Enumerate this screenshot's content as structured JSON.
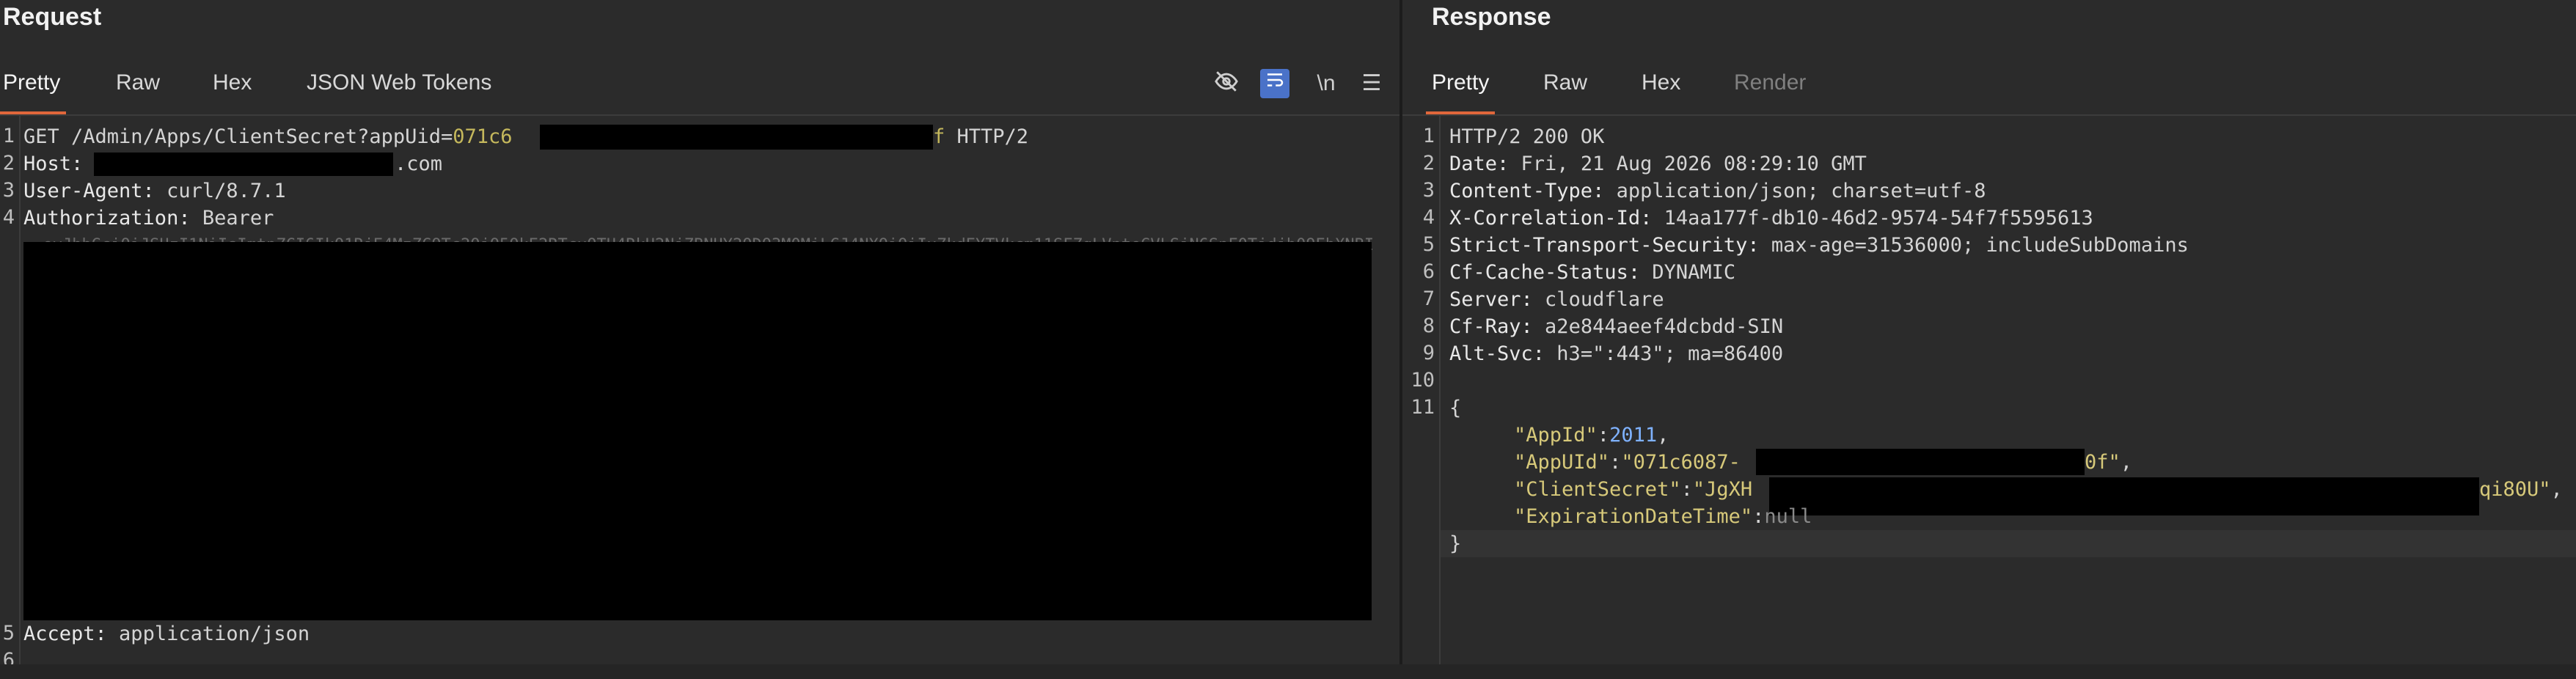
{
  "request": {
    "title": "Request",
    "tabs": [
      {
        "label": "Pretty",
        "active": true
      },
      {
        "label": "Raw"
      },
      {
        "label": "Hex"
      },
      {
        "label": "JSON Web Tokens"
      }
    ],
    "tools": {
      "hide_icon": "eye-slash-icon",
      "wrap_icon": "wrap-lines-icon",
      "newline_label": "\\n",
      "menu_icon": "menu-icon"
    },
    "line_numbers": [
      "1",
      "2",
      "3",
      "4",
      "5",
      "6"
    ],
    "lines": {
      "l1_method": "GET ",
      "l1_path": "/Admin/Apps/ClientSecret?appUid=",
      "l1_param": "071c6",
      "l1_tail_char": "f",
      "l1_proto": " HTTP/2",
      "l2_key": "Host:",
      "l2_val": ".com",
      "l3_key": "User-Agent:",
      "l3_val": " curl/8.7.1",
      "l4_key": "Authorization:",
      "l4_val": " Bearer",
      "l5_partial": "  eyJhbGciOiJSUzI1NiIsImtpZCI6IkQ1RjE4MzZCOTc2QjQ5QkE2RTcxQTU4RkU2NjZBNUY2ODQ3M0MiLCJ4NXQiOiIxZkdEYTVkcm11SFZqLVpteGVLSjN6SnF0Tjdjb09EbXNBIn0",
      "l6_key": "Accept:",
      "l6_val": " application/json"
    }
  },
  "response": {
    "title": "Response",
    "tabs": [
      {
        "label": "Pretty",
        "active": true
      },
      {
        "label": "Raw"
      },
      {
        "label": "Hex"
      },
      {
        "label": "Render",
        "disabled": true
      }
    ],
    "line_numbers": [
      "1",
      "2",
      "3",
      "4",
      "5",
      "6",
      "7",
      "8",
      "9",
      "10",
      "11"
    ],
    "lines": {
      "r1": "HTTP/2 200 OK",
      "r2_key": "Date:",
      "r2_val": " Fri, 21 Aug 2026 08:29:10 GMT",
      "r3_key": "Content-Type:",
      "r3_val": " application/json; charset=utf-8",
      "r4_key": "X-Correlation-Id:",
      "r4_val": " 14aa177f-db10-46d2-9574-54f7f5595613",
      "r5_key": "Strict-Transport-Security:",
      "r5_val": " max-age=31536000; includeSubDomains",
      "r6_key": "Cf-Cache-Status:",
      "r6_val": " DYNAMIC",
      "r7_key": "Server:",
      "r7_val": " cloudflare",
      "r8_key": "Cf-Ray:",
      "r8_val": " a2e844aeef4dcbdd-SIN",
      "r9_key": "Alt-Svc:",
      "r9_val": " h3=\":443\"; ma=86400",
      "brace_open": "{",
      "j1_key": "\"AppId\"",
      "j1_sep": ":",
      "j1_val": "2011",
      "j1_end": ",",
      "j2_key": "\"AppUId\"",
      "j2_sep": ":",
      "j2_val_start": "\"071c6087-",
      "j2_val_end": "0f\"",
      "j2_end": ",",
      "j3_key": "\"ClientSecret\"",
      "j3_sep": ":",
      "j3_val_start": "\"JgXH",
      "j3_val_end": "qi80U\"",
      "j3_end": ",",
      "j4_key": "\"ExpirationDateTime\"",
      "j4_sep": ":",
      "j4_val": "null",
      "brace_close": "}"
    }
  }
}
